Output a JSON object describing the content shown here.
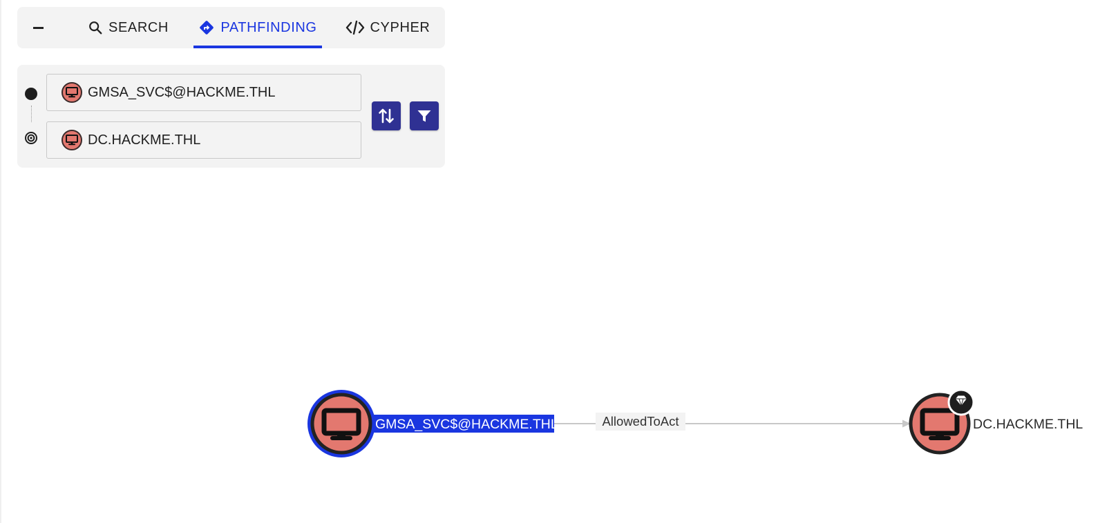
{
  "tabs": {
    "collapse_icon": "minus-icon",
    "search": {
      "label": "SEARCH",
      "icon": "search-icon"
    },
    "pathfinding": {
      "label": "PATHFINDING",
      "icon": "route-diamond-icon",
      "active": true
    },
    "cypher": {
      "label": "CYPHER",
      "icon": "code-icon"
    }
  },
  "pathfinding": {
    "start": {
      "value": "GMSA_SVC$@HACKME.THL",
      "icon": "computer-icon"
    },
    "target": {
      "value": "DC.HACKME.THL",
      "icon": "computer-icon"
    },
    "swap_icon": "swap-vertical-icon",
    "filter_icon": "filter-icon"
  },
  "graph": {
    "nodes": [
      {
        "label": "GMSA_SVC$@HACKME.THL",
        "type": "computer",
        "selected": true
      },
      {
        "label": "DC.HACKME.THL",
        "type": "computer",
        "tier_zero": true
      }
    ],
    "edge": {
      "label": "AllowedToAct"
    }
  },
  "colors": {
    "accent": "#1a36e0",
    "button": "#2f3193",
    "node_fill": "#e3786f",
    "panel_bg": "#f3f3f3"
  }
}
